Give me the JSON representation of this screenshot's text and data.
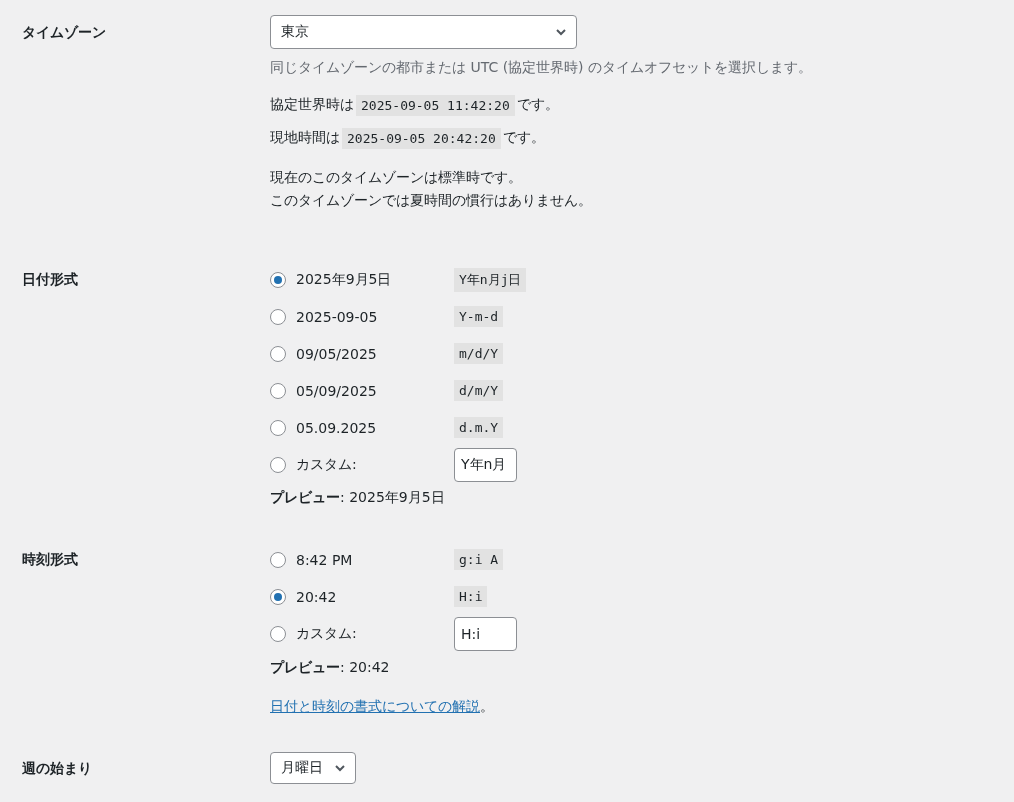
{
  "timezone": {
    "label": "タイムゾーン",
    "value": "東京",
    "description": "同じタイムゾーンの都市または UTC (協定世界時) のタイムオフセットを選択します。",
    "times": [
      {
        "prefix": "協定世界時は",
        "value": "2025-09-05 11:42:20",
        "suffix": "です。"
      },
      {
        "prefix": "現地時間は",
        "value": "2025-09-05 20:42:20",
        "suffix": "です。"
      }
    ],
    "notes": [
      "現在のこのタイムゾーンは標準時です。",
      "このタイムゾーンでは夏時間の慣行はありません。"
    ]
  },
  "date_format": {
    "label": "日付形式",
    "options": [
      {
        "kind": "preset",
        "label": "2025年9月5日",
        "code": "Y年n月j日",
        "selected": true
      },
      {
        "kind": "preset",
        "label": "2025-09-05",
        "code": "Y-m-d",
        "selected": false
      },
      {
        "kind": "preset",
        "label": "09/05/2025",
        "code": "m/d/Y",
        "selected": false
      },
      {
        "kind": "preset",
        "label": "05/09/2025",
        "code": "d/m/Y",
        "selected": false
      },
      {
        "kind": "preset",
        "label": "05.09.2025",
        "code": "d.m.Y",
        "selected": false
      },
      {
        "kind": "custom",
        "label": "カスタム:",
        "value": "Y年n月",
        "selected": false
      }
    ],
    "preview": "**プレビュー**: 2025年9月5日"
  },
  "time_format": {
    "label": "時刻形式",
    "options": [
      {
        "kind": "preset",
        "label": "8:42 PM",
        "code": "g:i A",
        "selected": false
      },
      {
        "kind": "preset",
        "label": "20:42",
        "code": "H:i",
        "selected": true
      },
      {
        "kind": "custom",
        "label": "カスタム:",
        "value": "H:i",
        "selected": false
      }
    ],
    "preview": "**プレビュー**: 20:42",
    "link": {
      "text": "日付と時刻の書式についての解説",
      "suffix": "。"
    }
  },
  "week_start": {
    "label": "週の始まり",
    "value": "月曜日"
  }
}
